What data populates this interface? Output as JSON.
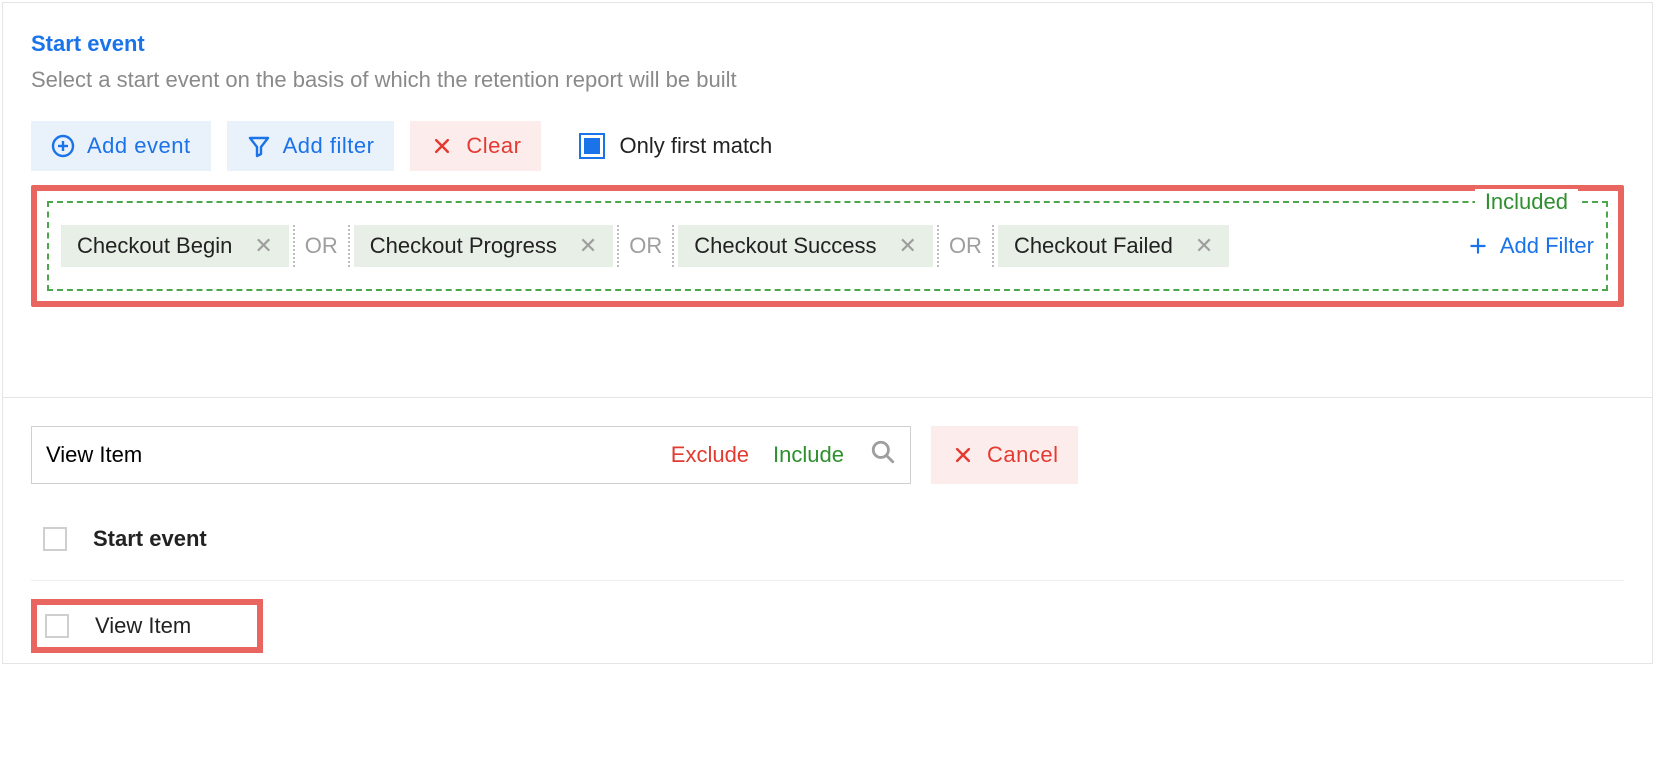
{
  "section": {
    "title": "Start event",
    "description": "Select a start event on the basis of which the retention report will be built"
  },
  "toolbar": {
    "add_event": "Add event",
    "add_filter": "Add filter",
    "clear": "Clear",
    "only_first_match": "Only first match"
  },
  "included": {
    "title": "Included",
    "or_label": "OR",
    "chips": [
      "Checkout Begin",
      "Checkout Progress",
      "Checkout Success",
      "Checkout Failed"
    ],
    "add_filter": "Add Filter"
  },
  "search": {
    "value": "View Item",
    "exclude": "Exclude",
    "include": "Include",
    "cancel": "Cancel"
  },
  "results": {
    "group_label": "Start event",
    "item": "View Item"
  }
}
